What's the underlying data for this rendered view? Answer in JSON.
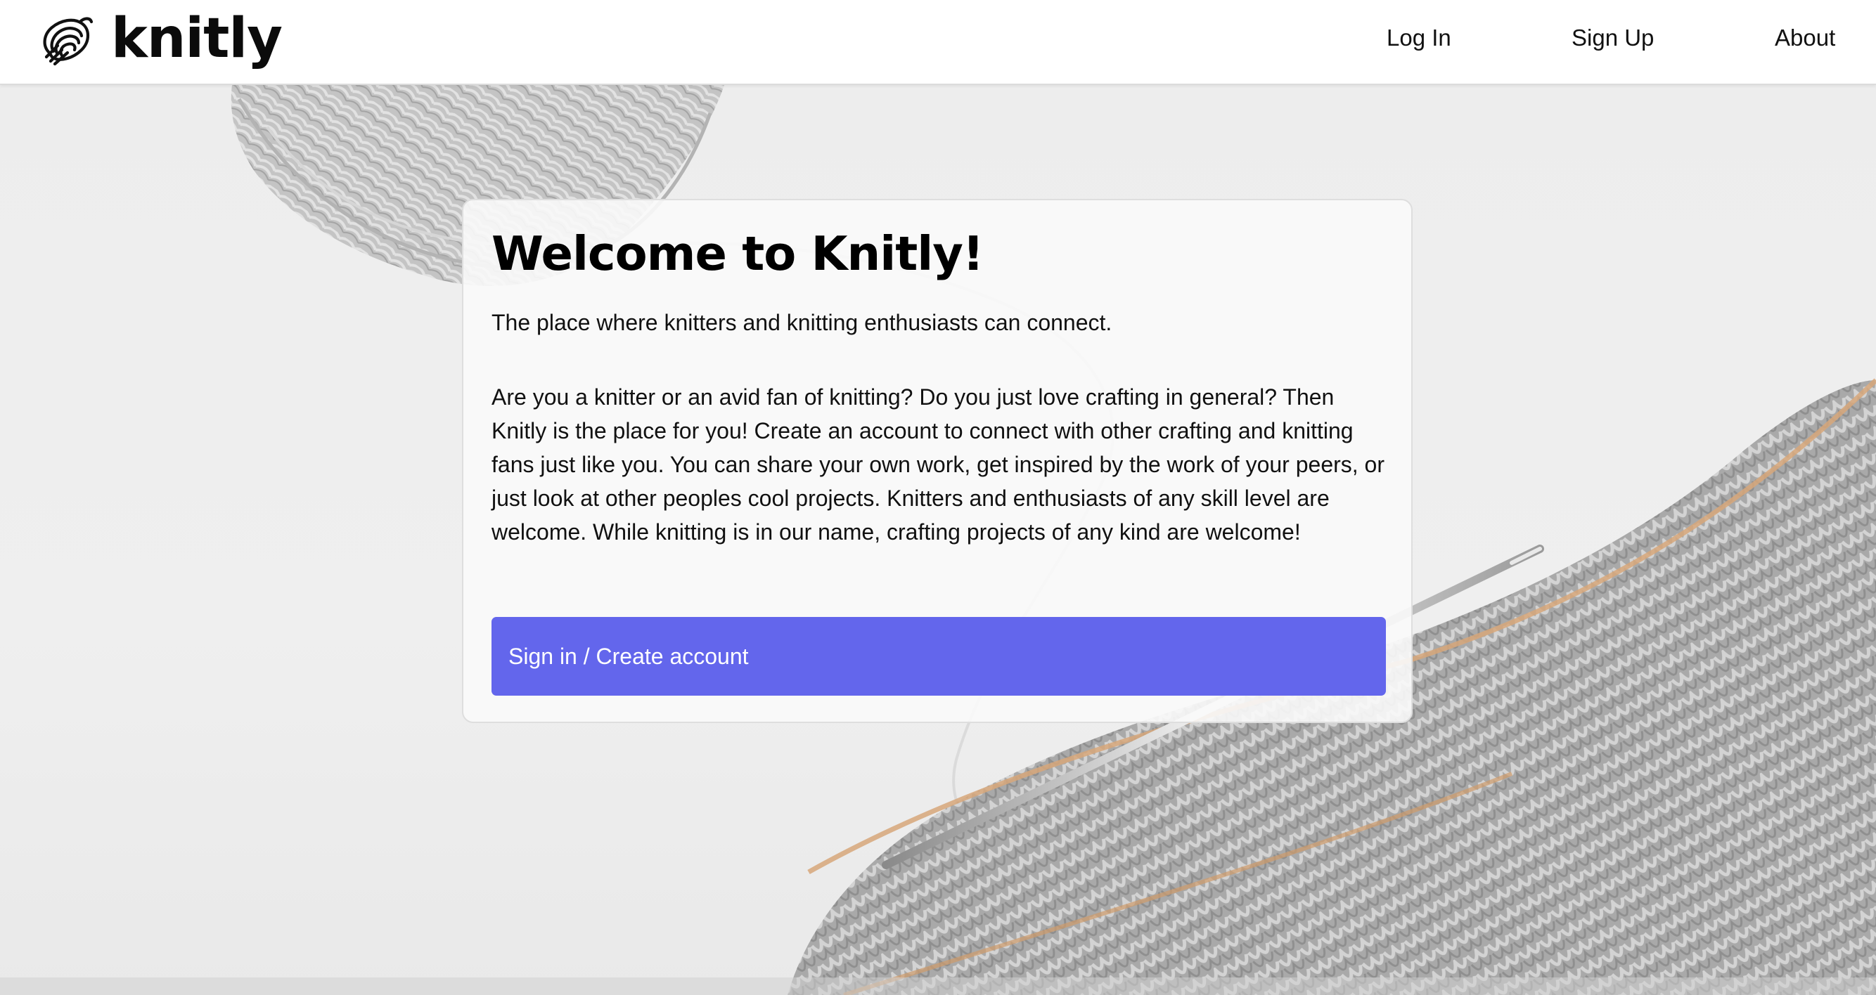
{
  "header": {
    "logo_text": "knitly",
    "logo_icon": "yarn-ball-icon",
    "nav": {
      "login_label": "Log In",
      "signup_label": "Sign Up",
      "about_label": "About"
    }
  },
  "hero": {
    "background_image": "knitting-with-yarn-and-needles-photo"
  },
  "card": {
    "title": "Welcome to Knitly!",
    "tagline": "The place where knitters and knitting enthusiasts can connect.",
    "body": "Are you a knitter or an avid fan of knitting? Do you just love crafting in general? Then Knitly is the place for you! Create an account to connect with other crafting and knitting fans just like you. You can share your own work, get inspired by the work of your peers, or just look at other peoples cool projects. Knitters and enthusiasts of any skill level are welcome. While knitting is in our name, crafting projects of any kind are welcome!",
    "cta_label": "Sign in / Create account"
  },
  "colors": {
    "accent": "#6366ec",
    "header_bg": "#ffffff",
    "page_bg": "#ececec",
    "text": "#111111"
  }
}
